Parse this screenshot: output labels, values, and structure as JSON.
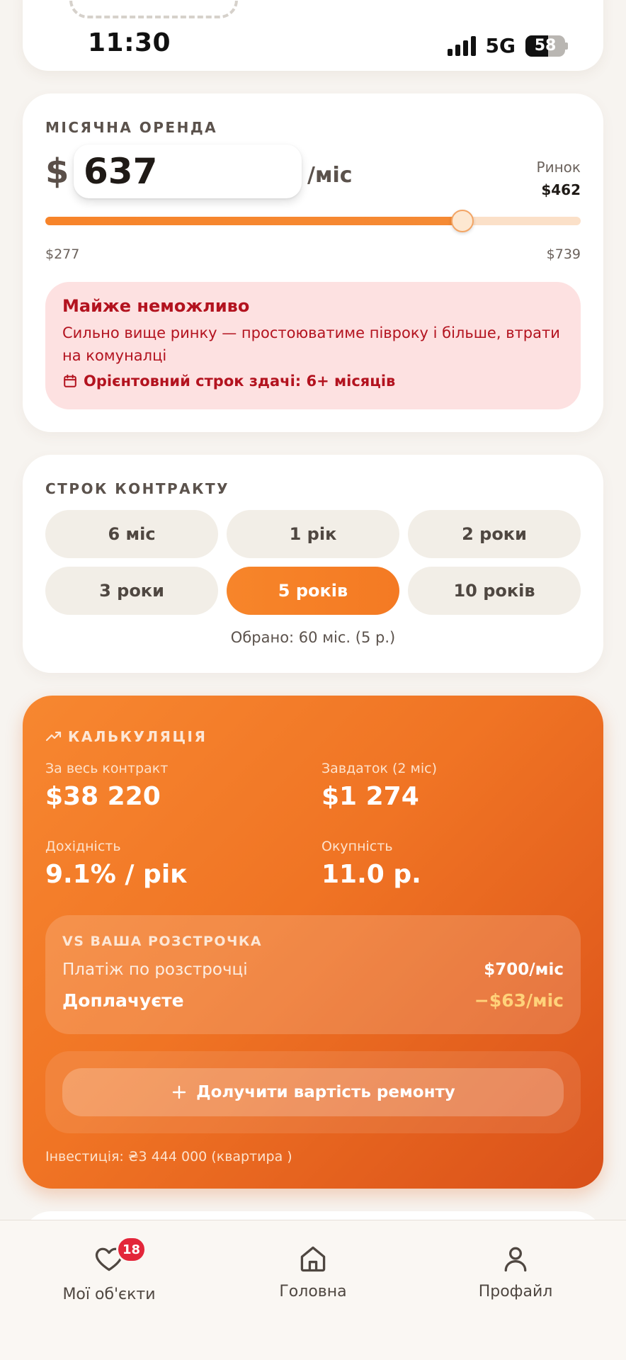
{
  "status_bar": {
    "time": "11:30",
    "network": "5G",
    "battery": "58",
    "battery_level": 0.58
  },
  "rent": {
    "section_label": "МІСЯЧНА ОРЕНДА",
    "currency_symbol": "$",
    "price_value": "637",
    "per_month": "/міс",
    "market_label": "Ринок",
    "market_value": "$462",
    "slider": {
      "min_label": "$277",
      "max_label": "$739",
      "min": 277,
      "max": 739,
      "value": 637
    },
    "alert": {
      "title": "Майже неможливо",
      "text": "Сильно вище ринку — простоюватиме півроку і більше, втрати на комуналці",
      "term": "Орієнтовний строк здачі: 6+ місяців"
    }
  },
  "contract": {
    "section_label": "СТРОК КОНТРАКТУ",
    "options": [
      "6 міс",
      "1 рік",
      "2 роки",
      "3 роки",
      "5 років",
      "10 років"
    ],
    "selected_index": 4,
    "selected_note": "Обрано: 60 міс. (5 р.)"
  },
  "calc": {
    "section_label": "КАЛЬКУЛЯЦІЯ",
    "total_label": "За весь контракт",
    "total_value": "$38 220",
    "deposit_label": "Завдаток (2 міс)",
    "deposit_value": "$1 274",
    "yield_label": "Дохідність",
    "yield_value": "9.1% / рік",
    "payback_label": "Окупність",
    "payback_value": "11.0 р.",
    "vs": {
      "title": "VS ВАША РОЗСТРОЧКА",
      "payment_label": "Платіж по розстрочці",
      "payment_value": "$700/міс",
      "extra_label": "Доплачуєте",
      "extra_value": "−$63/міс"
    },
    "repair_button": "Долучити вартість ремонту",
    "investment_note": "Інвестиція: ₴3 444 000 (квартира )"
  },
  "bottom_nav": {
    "items": [
      {
        "label": "Мої об'єкти",
        "icon": "heart-icon",
        "badge": "18"
      },
      {
        "label": "Головна",
        "icon": "home-icon"
      },
      {
        "label": "Профайл",
        "icon": "user-icon"
      }
    ]
  },
  "colors": {
    "accent": "#f7842a",
    "alert_bg": "#fde1e1",
    "alert_text": "#b3131f",
    "badge": "#e3263a",
    "highlight": "#ffd27a"
  }
}
